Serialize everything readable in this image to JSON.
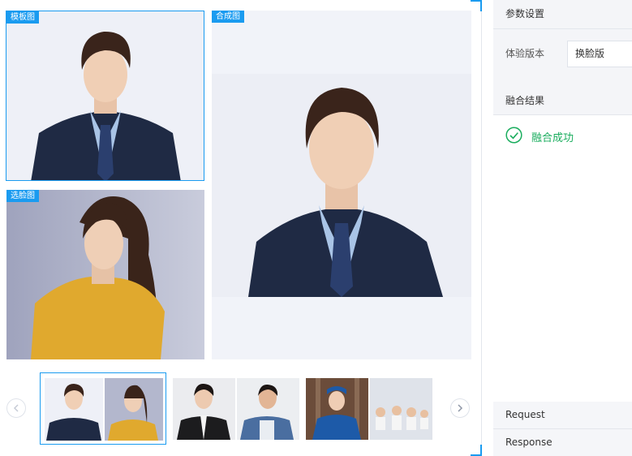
{
  "stage": {
    "template_tag": "模板图",
    "face_tag": "选脸图",
    "result_tag": "合成图"
  },
  "side": {
    "params_title": "参数设置",
    "version_label": "体验版本",
    "version_value": "换脸版",
    "result_title": "融合结果",
    "result_status": "融合成功",
    "request_label": "Request",
    "response_label": "Response"
  },
  "colors": {
    "accent": "#1a9bf0",
    "success": "#1aad5e"
  },
  "icons": {
    "prev": "chevron-left-icon",
    "next": "chevron-right-icon",
    "status": "check-circle-icon"
  }
}
